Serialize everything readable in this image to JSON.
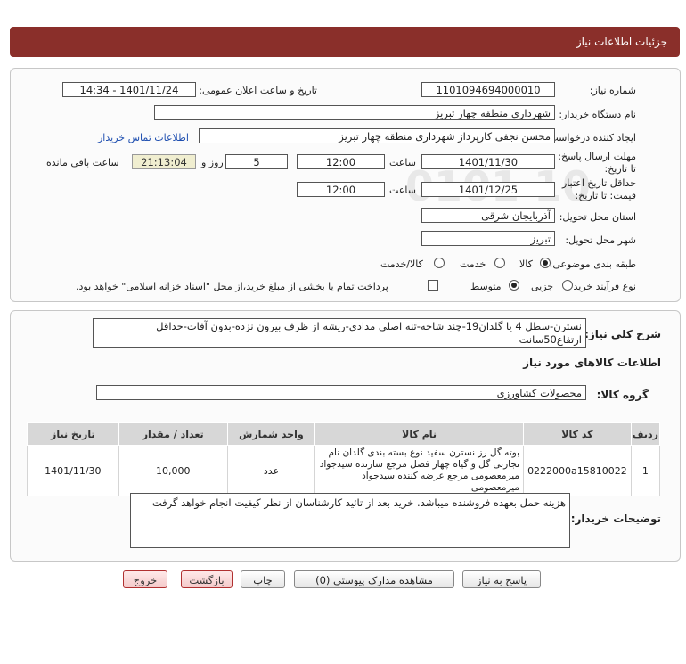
{
  "window": {
    "title": "جزئیات اطلاعات نیاز"
  },
  "details": {
    "need_number_label": "شماره نیاز:",
    "need_number": "1101094694000010",
    "announce_label": "تاریخ و ساعت اعلان عمومی:",
    "announce_value": "1401/11/24 - 14:34",
    "buyer_org_label": "نام دستگاه خریدار:",
    "buyer_org": "شهرداری منطقه چهار تبریز",
    "creator_label": "ایجاد کننده درخواست:",
    "creator": "محسن نجفی کارپرداز شهرداری منطقه چهار تبریز",
    "contact_link": "اطلاعات تماس خریدار",
    "reply_deadline_label": "مهلت ارسال پاسخ: تا تاریخ:",
    "reply_date": "1401/11/30",
    "time_label": "ساعت",
    "reply_time": "12:00",
    "days_value": "5",
    "days_label": "روز و",
    "remaining_value": "21:13:04",
    "remaining_label": "ساعت باقی مانده",
    "price_validity_label": "حداقل تاریخ اعتبار قیمت: تا تاریخ:",
    "validity_date": "1401/12/25",
    "validity_time_label": "ساعت",
    "validity_time": "12:00",
    "province_label": "استان محل تحویل:",
    "province": "آذربایجان شرقی",
    "city_label": "شهر محل تحویل:",
    "city": "تبریز",
    "category_label": "طبقه بندی موضوعی:",
    "category_options": [
      "کالا",
      "خدمت",
      "کالا/خدمت"
    ],
    "process_label": "نوع فرآیند خرید :",
    "process_options": [
      "جزیی",
      "متوسط"
    ],
    "payment_note": "پرداخت تمام یا بخشی از مبلغ خرید،از محل \"اسناد خزانه اسلامی\" خواهد بود."
  },
  "summary": {
    "general_desc_label": "شرح کلی نیاز:",
    "general_desc": "نسترن-سطل 4 یا گلدان19-چند شاخه-تنه اصلی مدادی-ریشه از ظرف بیرون نزده-بدون آفات-حداقل ارتفاع50سانت",
    "goods_info_title": "اطلاعات کالاهای مورد نیاز",
    "goods_group_label": "گروه کالا:",
    "goods_group": "محصولات کشاورزی",
    "table": {
      "headers": [
        "ردیف",
        "کد کالا",
        "نام کالا",
        "واحد شمارش",
        "تعداد / مقدار",
        "تاریخ نیاز"
      ],
      "rows": [
        {
          "row": "1",
          "code": "0222000a15810022",
          "name": "بوته گل رز نسترن سفید نوع بسته بندی گلدان نام تجارتی گل و گیاه چهار فصل مرجع سازنده سیدجواد میرمعصومی مرجع عرضه کننده سیدجواد میرمعصومی",
          "unit": "عدد",
          "qty": "10,000",
          "date": "1401/11/30"
        }
      ]
    },
    "buyer_notes_label": "توضیحات خریدار:",
    "buyer_notes": "هزینه حمل بعهده فروشنده میباشد. خرید بعد از تائید کارشناسان از نظر کیفیت انجام خواهد گرفت"
  },
  "buttons": {
    "reply": "پاسخ به نیاز",
    "view_docs": "مشاهده مدارک پیوستی (0)",
    "print": "چاپ",
    "back": "بازگشت",
    "exit": "خروج"
  }
}
